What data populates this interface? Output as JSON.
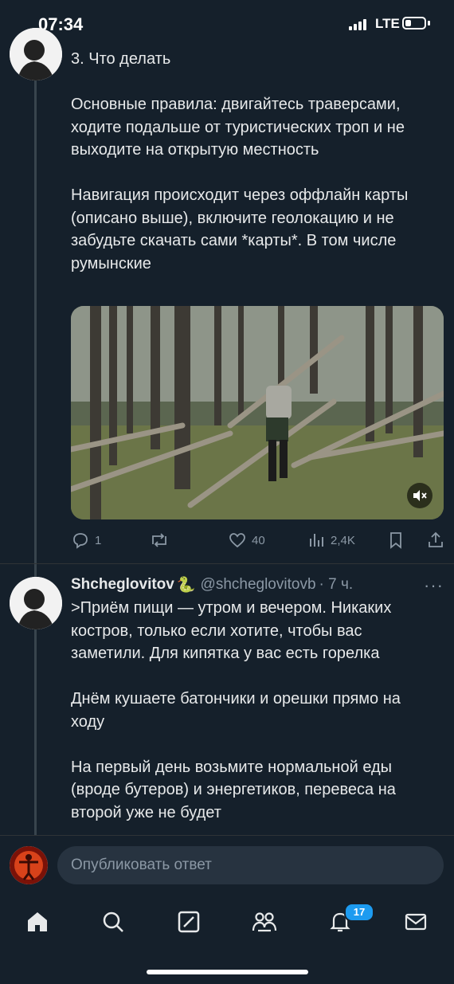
{
  "status": {
    "time": "07:34",
    "network": "LTE",
    "battery_level": 0.3
  },
  "tweet1": {
    "text": "3. Что делать\n\nОсновные правила: двигайтесь траверсами, ходите подальше от туристических троп и не выходите на открытую местность\n\nНавигация происходит через оффлайн карты (описано выше), включите геолокацию и не забудьте скачать сами *карты*. В том числе румынские",
    "media": {
      "description_icon": "photo-forest"
    },
    "actions": {
      "replies": "1",
      "retweets": "",
      "likes": "40",
      "views": "2,4K"
    }
  },
  "tweet2": {
    "author_name": "Shcheglovitov",
    "author_emoji": "🐍",
    "handle": "@shcheglovitovb",
    "time": "· 7 ч.",
    "more": "···",
    "text": ">Приём пищи — утром и вечером. Никаких костров, только если хотите, чтобы вас заметили. Для кипятка у вас есть горелка\n\nДнём кушаете батончики и орешки прямо на ходу\n\nНа первый день возьмите нормальной еды (вроде бутеров) и энергетиков, перевеса на второй уже не будет"
  },
  "reply": {
    "placeholder": "Опубликовать ответ"
  },
  "tabbar": {
    "notifications_badge": "17"
  },
  "colors": {
    "background": "#15202b",
    "text": "#e7e9ea",
    "muted": "#8b98a5",
    "accent": "#1d9bf0"
  }
}
